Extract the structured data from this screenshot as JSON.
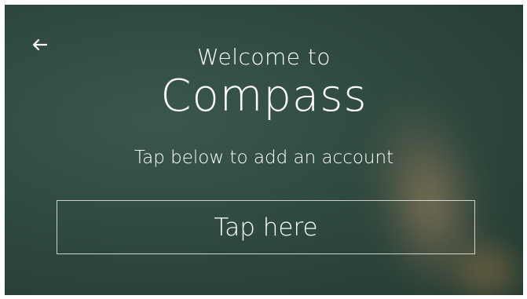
{
  "header": {
    "back_icon": "arrow-left-icon",
    "welcome_text": "Welcome to",
    "app_name": "Compass"
  },
  "main": {
    "subtitle": "Tap below to add an account",
    "tap_button_label": "Tap here"
  },
  "colors": {
    "background": "#2f4a40",
    "text": "#ffffff"
  }
}
